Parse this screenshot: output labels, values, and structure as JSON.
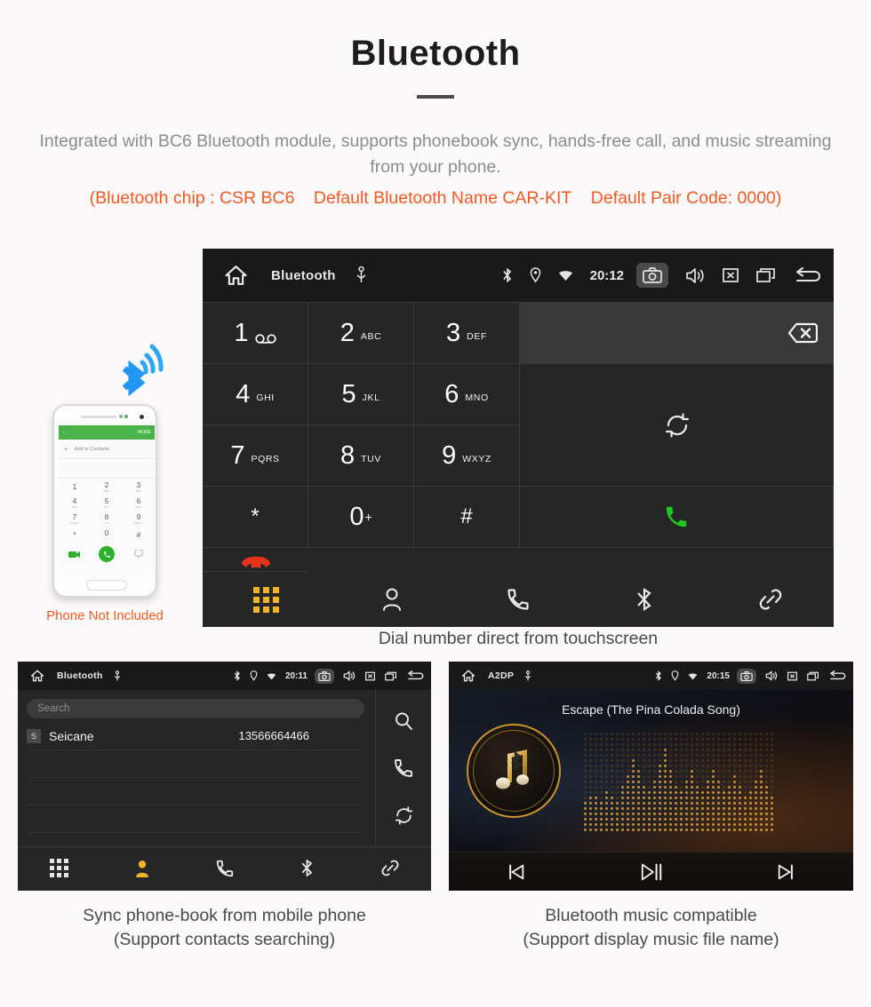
{
  "header": {
    "title": "Bluetooth",
    "intro": "Integrated with BC6 Bluetooth module, supports phonebook sync, hands-free call, and music streaming from your phone.",
    "spec_chip": "(Bluetooth chip : CSR BC6",
    "spec_name": "Default Bluetooth Name CAR-KIT",
    "spec_pair": "Default Pair Code: 0000)",
    "accent_color": "#f15a24",
    "text_color": "#8c8c8c"
  },
  "dialer": {
    "statusbar": {
      "title": "Bluetooth",
      "time": "20:12",
      "icons_left": [
        "home-icon",
        "usb-icon"
      ],
      "icons_right": [
        "bluetooth-icon",
        "location-icon",
        "wifi-icon",
        "camera-icon",
        "volume-icon",
        "close-icon",
        "recents-icon",
        "back-icon"
      ]
    },
    "keys": [
      {
        "digit": "1",
        "sub": "",
        "voicemail": true
      },
      {
        "digit": "2",
        "sub": "ABC"
      },
      {
        "digit": "3",
        "sub": "DEF"
      },
      {
        "digit": "4",
        "sub": "GHI"
      },
      {
        "digit": "5",
        "sub": "JKL"
      },
      {
        "digit": "6",
        "sub": "MNO"
      },
      {
        "digit": "7",
        "sub": "PQRS"
      },
      {
        "digit": "8",
        "sub": "TUV"
      },
      {
        "digit": "9",
        "sub": "WXYZ"
      },
      {
        "digit": "*",
        "sub": ""
      },
      {
        "digit": "0",
        "sub": "",
        "plus": "+"
      },
      {
        "digit": "#",
        "sub": ""
      }
    ],
    "number_display": "",
    "backspace_icon": "backspace-icon",
    "sync_icon": "sync-icon",
    "call_icon": "call-icon",
    "end_call_icon": "end-call-icon",
    "call_color": "#21c721",
    "end_color": "#e8331c",
    "tabs": [
      {
        "name": "keypad",
        "icon": "keypad-icon",
        "active": true
      },
      {
        "name": "contacts",
        "icon": "contact-icon",
        "active": false
      },
      {
        "name": "call-log",
        "icon": "handset-icon",
        "active": false
      },
      {
        "name": "bluetooth",
        "icon": "bluetooth-icon",
        "active": false
      },
      {
        "name": "pair",
        "icon": "link-icon",
        "active": false
      }
    ],
    "active_tab_color": "#f0b429",
    "caption": "Dial number direct from touchscreen"
  },
  "phone_illustration": {
    "app_more_label": "MORE",
    "add_contacts_label": "Add to Contacts",
    "keys": [
      {
        "d": "1",
        "s": ""
      },
      {
        "d": "2",
        "s": "ABC"
      },
      {
        "d": "3",
        "s": "DEF"
      },
      {
        "d": "4",
        "s": "GHI"
      },
      {
        "d": "5",
        "s": "JKL"
      },
      {
        "d": "6",
        "s": "MNO"
      },
      {
        "d": "7",
        "s": "PQRS"
      },
      {
        "d": "8",
        "s": "TUV"
      },
      {
        "d": "9",
        "s": "WXYZ"
      },
      {
        "d": "*",
        "s": ""
      },
      {
        "d": "0",
        "s": "+"
      },
      {
        "d": "#",
        "s": ""
      }
    ],
    "note": "Phone Not Included",
    "note_color": "#f15a24",
    "bluetooth_icon_color": "#2196f3"
  },
  "phonebook": {
    "statusbar": {
      "title": "Bluetooth",
      "time": "20:11"
    },
    "search_placeholder": "Search",
    "contacts": [
      {
        "initial": "S",
        "name": "Seicane",
        "number": "13566664466"
      }
    ],
    "side_actions": [
      "search-icon",
      "call-icon",
      "sync-icon"
    ],
    "tabs": [
      {
        "name": "keypad",
        "icon": "keypad-icon",
        "active": false
      },
      {
        "name": "contacts",
        "icon": "contact-icon",
        "active": true
      },
      {
        "name": "call-log",
        "icon": "handset-icon",
        "active": false
      },
      {
        "name": "bluetooth",
        "icon": "bluetooth-icon",
        "active": false
      },
      {
        "name": "pair",
        "icon": "link-icon",
        "active": false
      }
    ],
    "caption_line1": "Sync phone-book from mobile phone",
    "caption_line2": "(Support contacts searching)"
  },
  "music": {
    "statusbar": {
      "title": "A2DP",
      "time": "20:15"
    },
    "track_title": "Escape (The Pina Colada Song)",
    "album_icon": "music-note-bluetooth-icon",
    "controls": [
      {
        "name": "previous",
        "icon": "skip-previous-icon"
      },
      {
        "name": "play-pause",
        "icon": "play-pause-icon"
      },
      {
        "name": "next",
        "icon": "skip-next-icon"
      }
    ],
    "accent_color": "#c9922e",
    "caption_line1": "Bluetooth music compatible",
    "caption_line2": "(Support display music file name)"
  }
}
